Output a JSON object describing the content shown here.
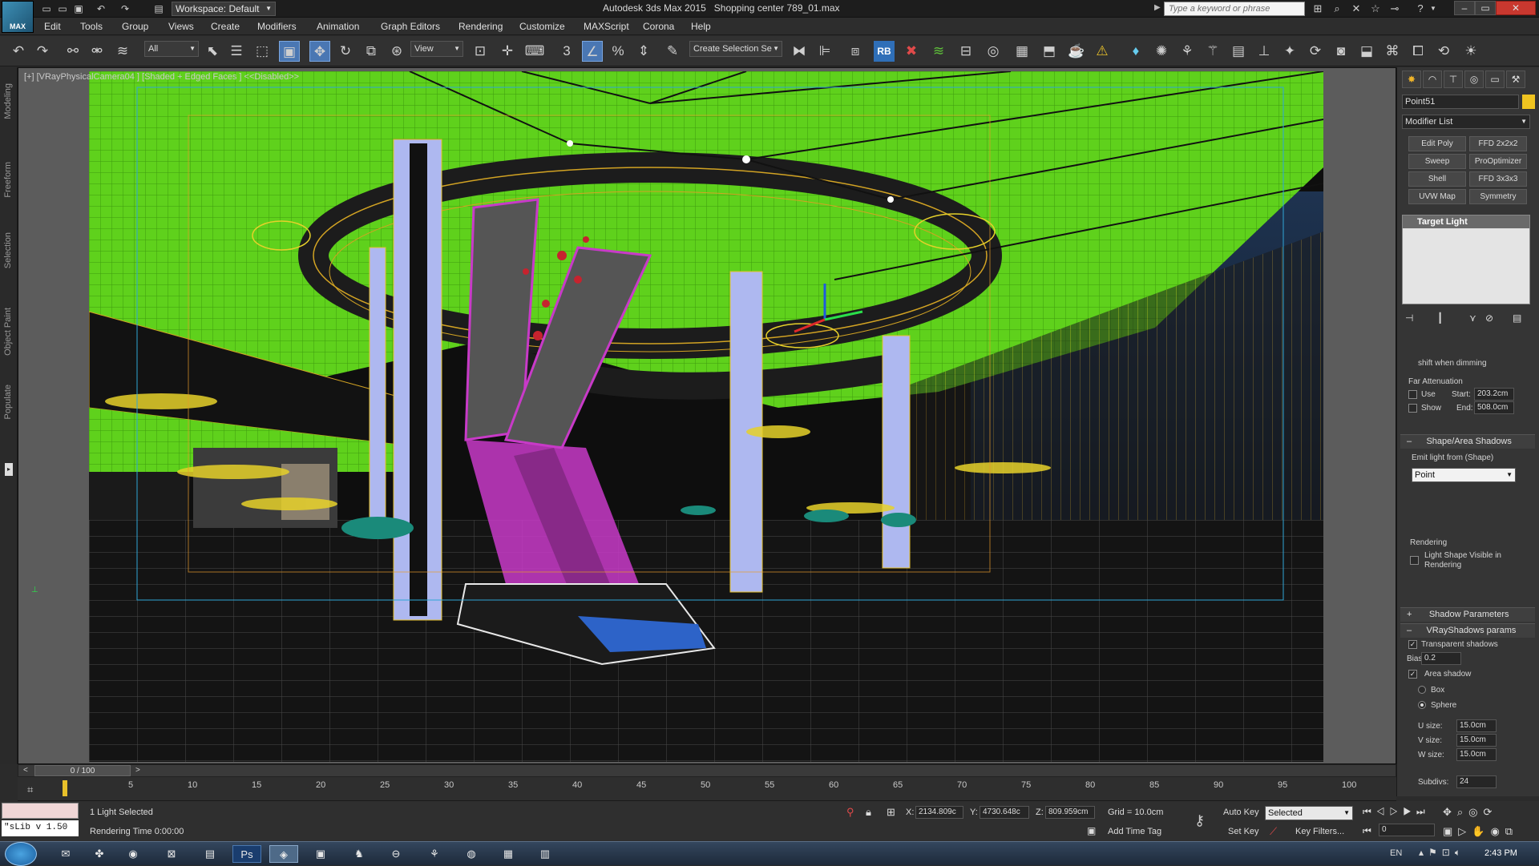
{
  "titlebar": {
    "workspace": "Workspace: Default",
    "app_title": "Autodesk 3ds Max  2015",
    "file_name": "Shopping center 789_01.max",
    "search_placeholder": "Type a keyword or phrase",
    "logo_text": "MAX"
  },
  "menu": [
    "Edit",
    "Tools",
    "Group",
    "Views",
    "Create",
    "Modifiers",
    "Animation",
    "Graph Editors",
    "Rendering",
    "Customize",
    "MAXScript",
    "Corona",
    "Help"
  ],
  "toolbar": {
    "filter_value": "All",
    "refcoord_value": "View",
    "selection_set_placeholder": "Create Selection Se",
    "rb_label": "RB"
  },
  "left_ribbon": [
    "Modeling",
    "Freeform",
    "Selection",
    "Object Paint",
    "Populate"
  ],
  "viewport": {
    "label": "[+] [VRayPhysicalCamera04 ] [Shaded + Edged Faces ]  <<Disabled>>"
  },
  "command_panel": {
    "object_name": "Point51",
    "modifier_list": "Modifier List",
    "modifiers": [
      "Edit Poly",
      "FFD 2x2x2",
      "Sweep",
      "ProOptimizer",
      "Shell",
      "FFD 3x3x3",
      "UVW Map",
      "Symmetry"
    ],
    "stack_item": "Target Light",
    "shift_dimming": "shift when dimming",
    "far_attenuation": "Far Attenuation",
    "use_label": "Use",
    "show_label": "Show",
    "start_label": "Start:",
    "start_value": "203.2cm",
    "end_label": "End:",
    "end_value": "508.0cm",
    "shape_area_shadows": "Shape/Area Shadows",
    "emit_from": "Emit light from (Shape)",
    "emit_shape": "Point",
    "rendering_label": "Rendering",
    "light_shape_visible": "Light Shape Visible in Rendering",
    "shadow_params": "Shadow Parameters",
    "vray_shadows": "VRayShadows params",
    "transparent_shadows": "Transparent shadows",
    "bias_label": "Bias:",
    "bias_value": "0.2",
    "area_shadow": "Area shadow",
    "box_label": "Box",
    "sphere_label": "Sphere",
    "u_size_label": "U size:",
    "u_size": "15.0cm",
    "v_size_label": "V size:",
    "v_size": "15.0cm",
    "w_size_label": "W size:",
    "w_size": "15.0cm",
    "subdivs_label": "Subdivs:",
    "subdivs": "24"
  },
  "timeline": {
    "frame_display": "0 / 100",
    "ticks": [
      "5",
      "10",
      "15",
      "20",
      "25",
      "30",
      "35",
      "40",
      "45",
      "50",
      "55",
      "60",
      "65",
      "70",
      "75",
      "80",
      "85",
      "90",
      "95",
      "100"
    ]
  },
  "status": {
    "selection": "1 Light Selected",
    "render_time": "Rendering Time  0:00:00",
    "script_label": "\"sLib v 1.50",
    "x_label": "X:",
    "x": "2134.809c",
    "y_label": "Y:",
    "y": "4730.648c",
    "z_label": "Z:",
    "z": "809.959cm",
    "grid": "Grid = 10.0cm",
    "add_time_tag": "Add Time Tag",
    "auto_key": "Auto Key",
    "selected": "Selected",
    "set_key": "Set Key",
    "key_filters": "Key Filters...",
    "frame_field": "0"
  },
  "taskbar": {
    "lang": "EN",
    "time": "2:43 PM"
  },
  "colors": {
    "ceiling": "#5fd11c",
    "wire_yellow": "#e6c12a",
    "escalator": "#c83ac8",
    "selection_blue": "#4a77b3"
  }
}
